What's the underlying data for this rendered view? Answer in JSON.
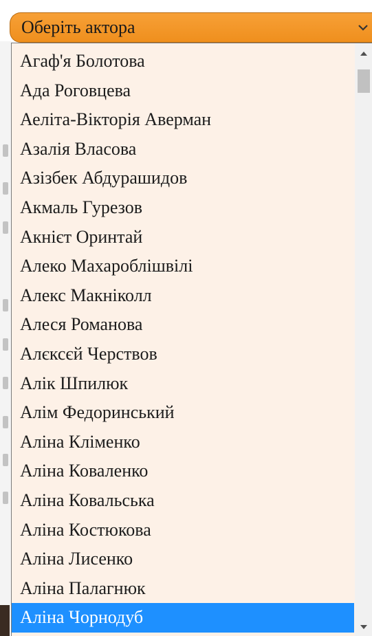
{
  "select": {
    "placeholder": "Оберіть актора",
    "arrow_icon": "chevron-down-icon",
    "background_color": "#ef8f1d"
  },
  "dropdown": {
    "options": [
      "Агаф'я Болотова",
      "Ада Роговцева",
      "Аеліта-Вікторія Аверман",
      "Азалія Власова",
      "Азізбек Абдурашидов",
      "Акмаль Гурезов",
      "Акнієт Оринтай",
      "Алеко Махароблішвілі",
      "Алекс Макніколл",
      "Алеся Романова",
      "Алєксєй Черствов",
      "Алік Шпилюк",
      "Алім Федоринський",
      "Аліна Кліменко",
      "Аліна Коваленко",
      "Аліна Ковальська",
      "Аліна Костюкова",
      "Аліна Лисенко",
      "Аліна Палагнюк",
      "Аліна Чорнодуб"
    ],
    "selected": "Аліна Чорнодуб",
    "selected_color": "#1e90ff",
    "background_color": "#fdf1e7"
  },
  "scrollbar": {
    "up_icon": "scroll-up-arrow-icon",
    "down_icon": "scroll-down-arrow-icon"
  }
}
